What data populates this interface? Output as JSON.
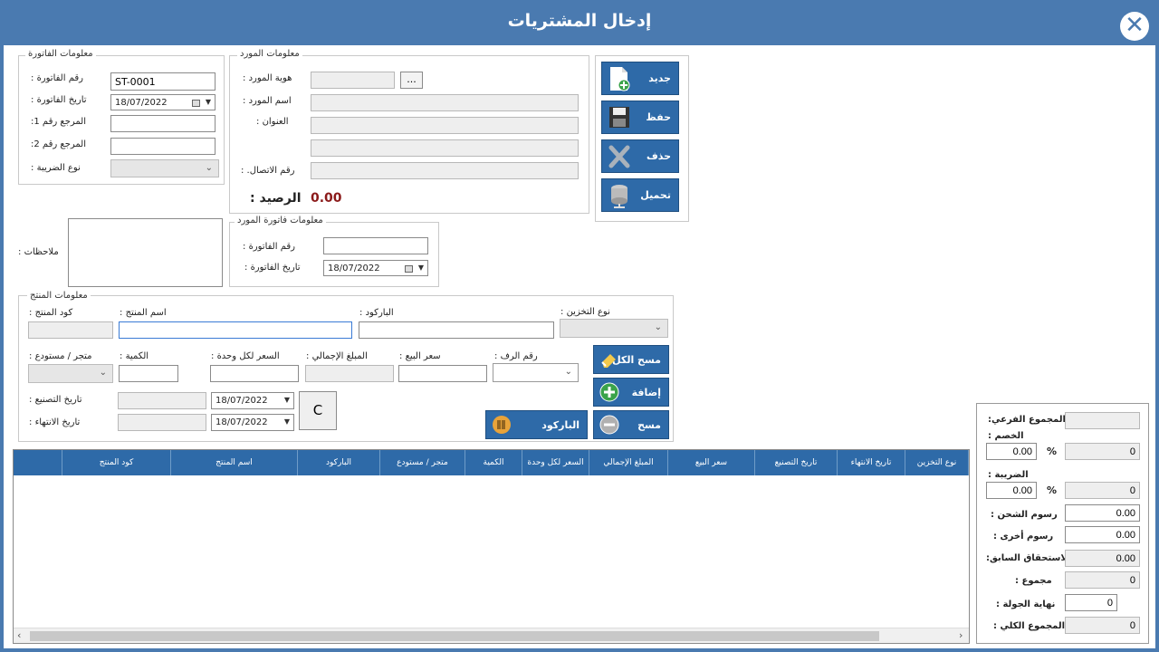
{
  "window": {
    "title": "إدخال المشتريات",
    "close_icon": "close-icon"
  },
  "invoice_info": {
    "legend": "معلومات الفاتورة",
    "invoice_no_label": ": رقم الفاتورة",
    "invoice_no_value": "ST-0001",
    "invoice_date_label": ": تاريخ الفاتورة",
    "invoice_date_value": "18/07/2022",
    "ref1_label": ":المرجع رقم 1",
    "ref2_label": ":المرجع رقم 2",
    "tax_type_label": ": نوع الضريبة"
  },
  "supplier_info": {
    "legend": "معلومات المورد",
    "supplier_id_label": ": هوية المورد",
    "browse_label": "...",
    "supplier_name_label": ": اسم المورد",
    "address_label": ": العنوان",
    "contact_label": ": .رقم الاتصال",
    "balance_label": ": الرصيد",
    "balance_value": "0.00"
  },
  "actions": {
    "new_label": "جديد",
    "save_label": "حفظ",
    "delete_label": "حذف",
    "load_label": "تحميل"
  },
  "notes": {
    "label": ": ملاحظات"
  },
  "supplier_invoice": {
    "legend": "معلومات فاتورة المورد",
    "invoice_no_label": ": رقم الفاتورة",
    "invoice_date_label": ": تاريخ الفاتورة",
    "invoice_date_value": "18/07/2022"
  },
  "product_info": {
    "legend": "معلومات المنتج",
    "code_label": ": كود المنتج",
    "name_label": ": اسم المنتج",
    "barcode_label": ": الباركود",
    "storage_type_label": ": نوع التخزين",
    "store_label": ": متجر / مستودع",
    "qty_label": ": الكمية",
    "unit_price_label": ": السعر لكل وحدة",
    "total_label": ": المبلغ الإجمالي",
    "sale_price_label": ": سعر البيع",
    "shelf_label": ": رقم الرف",
    "mfg_date_label": ": تاريخ التصنيع",
    "mfg_date_value": "18/07/2022",
    "exp_date_label": ": تاريخ الانتهاء",
    "exp_date_value": "18/07/2022",
    "c_label": "C",
    "clear_all_label": "مسح الكل",
    "add_label": "إضافة",
    "clear_label": "مسح",
    "barcode_btn_label": "الباركود"
  },
  "grid": {
    "columns": [
      "نوع التخزين",
      "تاريخ الانتهاء",
      "تاريخ التصنيع",
      "سعر البيع",
      "المبلغ الإجمالي",
      "السعر لكل وحدة",
      "الكمية",
      "متجر / مستودع",
      "الباركود",
      "اسم المنتج",
      "كود المنتج"
    ]
  },
  "summary": {
    "subtotal_label": ":المجموع الفرعي",
    "discount_label": ": الخصم",
    "discount_pct": "0.00",
    "discount_value": "0",
    "tax_label": ": الضريبة",
    "tax_pct": "0.00",
    "tax_value": "0",
    "pct_sign": "%",
    "shipping_label": ": رسوم الشحن",
    "shipping_value": "0.00",
    "other_label": ": رسوم أخرى",
    "other_value": "0.00",
    "prev_due_label": ":الاستحقاق السابق",
    "prev_due_value": "0.00",
    "total_label": ": مجموع",
    "total_value": "0",
    "round_label": ": نهاية الجولة",
    "round_value": "0",
    "grand_total_label": ": المجموع الكلي",
    "grand_total_value": "0"
  },
  "colors": {
    "accent": "#4a7ab0",
    "button": "#2e6aa8",
    "balance": "#8b1a1a"
  }
}
